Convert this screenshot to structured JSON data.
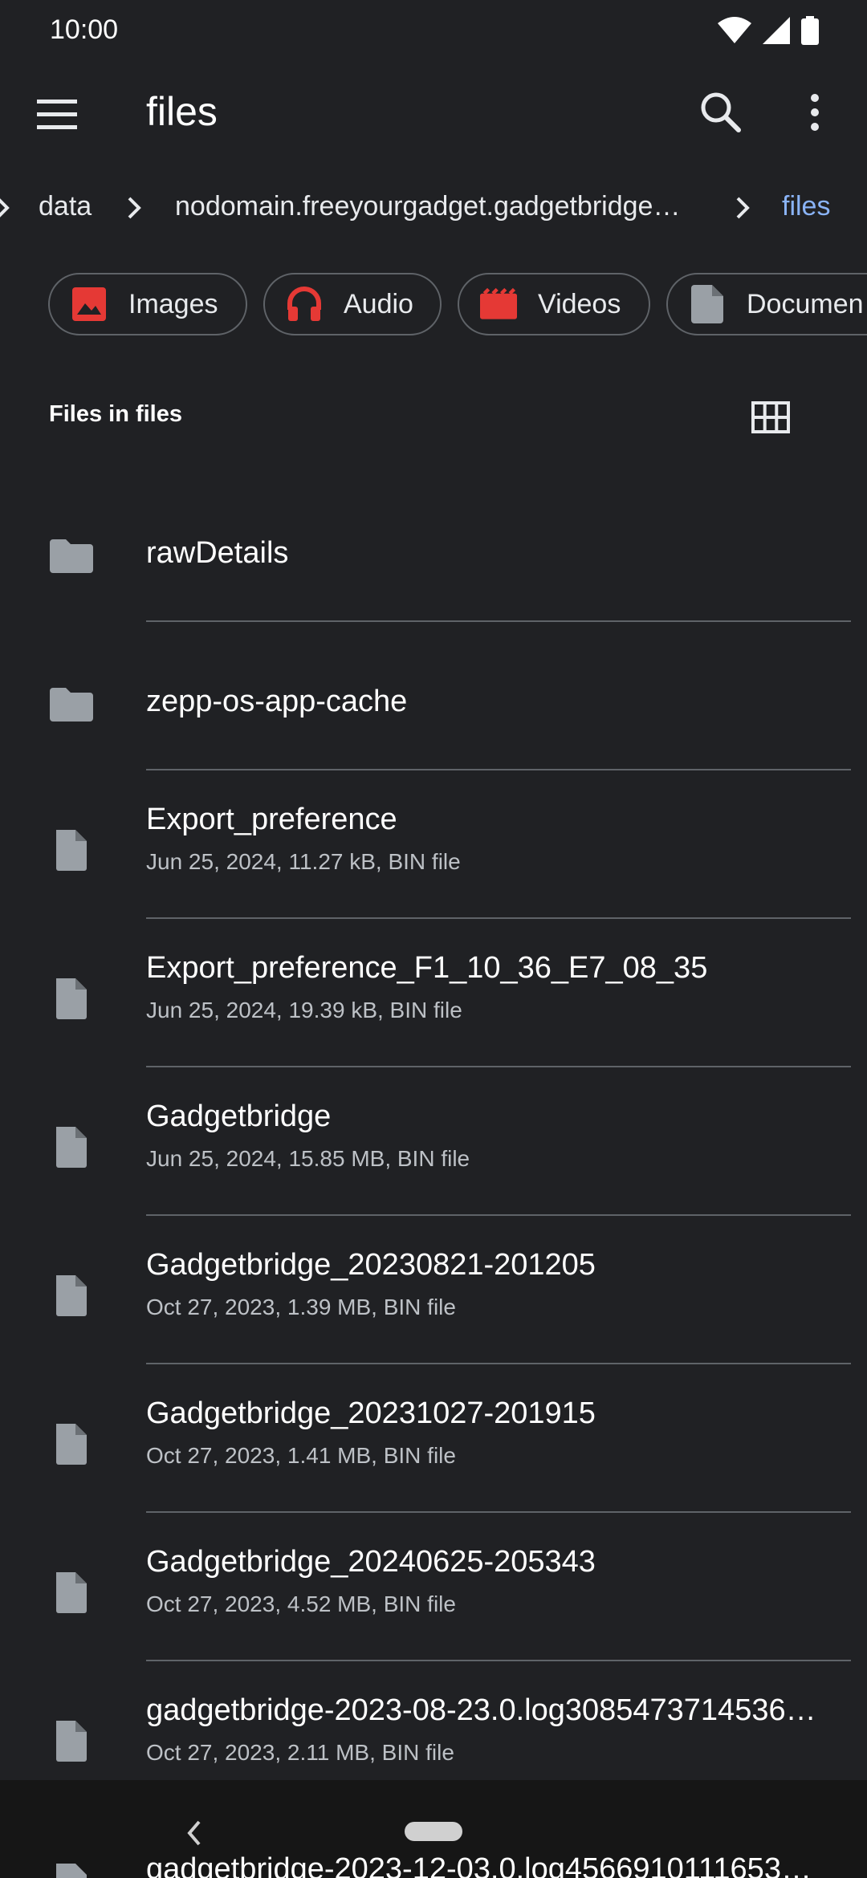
{
  "status": {
    "time": "10:00",
    "icons": [
      "wifi-icon",
      "signal-icon",
      "battery-icon"
    ]
  },
  "appbar": {
    "title": "files",
    "icons": [
      "menu-icon",
      "search-icon",
      "more-vert-icon"
    ]
  },
  "breadcrumbs": {
    "items": [
      "data",
      "nodomain.freeyourgadget.gadgetbridge…",
      "files"
    ]
  },
  "chips": [
    {
      "label": "Images",
      "icon": "image-icon",
      "color": "#e53935"
    },
    {
      "label": "Audio",
      "icon": "headphones-icon",
      "color": "#e53935"
    },
    {
      "label": "Videos",
      "icon": "movie-icon",
      "color": "#e53935"
    },
    {
      "label": "Documen",
      "icon": "document-icon",
      "color": "#9aa0a6"
    }
  ],
  "section": {
    "header": "Files in files",
    "view_toggle_icon": "grid-view-icon"
  },
  "files": [
    {
      "name": "rawDetails",
      "meta": "",
      "type": "folder"
    },
    {
      "name": "zepp-os-app-cache",
      "meta": "",
      "type": "folder"
    },
    {
      "name": "Export_preference",
      "meta": "Jun 25, 2024, 11.27 kB, BIN file",
      "type": "file"
    },
    {
      "name": "Export_preference_F1_10_36_E7_08_35",
      "meta": "Jun 25, 2024, 19.39 kB, BIN file",
      "type": "file"
    },
    {
      "name": "Gadgetbridge",
      "meta": "Jun 25, 2024, 15.85 MB, BIN file",
      "type": "file"
    },
    {
      "name": "Gadgetbridge_20230821-201205",
      "meta": "Oct 27, 2023, 1.39 MB, BIN file",
      "type": "file"
    },
    {
      "name": "Gadgetbridge_20231027-201915",
      "meta": "Oct 27, 2023, 1.41 MB, BIN file",
      "type": "file"
    },
    {
      "name": "Gadgetbridge_20240625-205343",
      "meta": "Oct 27, 2023, 4.52 MB, BIN file",
      "type": "file"
    },
    {
      "name": "gadgetbridge-2023-08-23.0.log3085473714536…",
      "meta": "Oct 27, 2023, 2.11 MB, BIN file",
      "type": "file"
    },
    {
      "name": "gadgetbridge-2023-12-03.0.log4566910111653…",
      "meta": "",
      "type": "file"
    }
  ],
  "navbar": {
    "icons": [
      "back-icon",
      "home-pill"
    ]
  }
}
